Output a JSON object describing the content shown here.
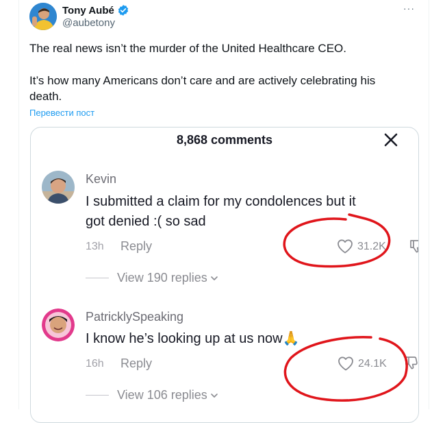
{
  "tweet": {
    "author_name": "Tony Aubé",
    "handle": "@aubetony",
    "more_label": "···",
    "text_line1": "The real news isn’t the murder of the United Healthcare CEO.",
    "text_line2": "It’s how many Americans don’t care and are actively celebrating his",
    "text_line3": "death.",
    "translate_label": "Перевести пост",
    "verified_color": "#1d9bf0"
  },
  "comments_panel": {
    "title": "8,868 comments",
    "comments": [
      {
        "username": "Kevin",
        "text_line1": "I submitted a claim for my condolences but it",
        "text_line2": "got denied :( so sad",
        "time": "13h",
        "reply_label": "Reply",
        "likes": "31.2K",
        "view_replies": "View 190 replies"
      },
      {
        "username": "PatricklySpeaking",
        "text_line1": "I know he’s looking up at us now",
        "emoji": "🙏",
        "time": "16h",
        "reply_label": "Reply",
        "likes": "24.1K",
        "view_replies": "View 106 replies"
      }
    ]
  },
  "annotation_color": "#e0151b"
}
